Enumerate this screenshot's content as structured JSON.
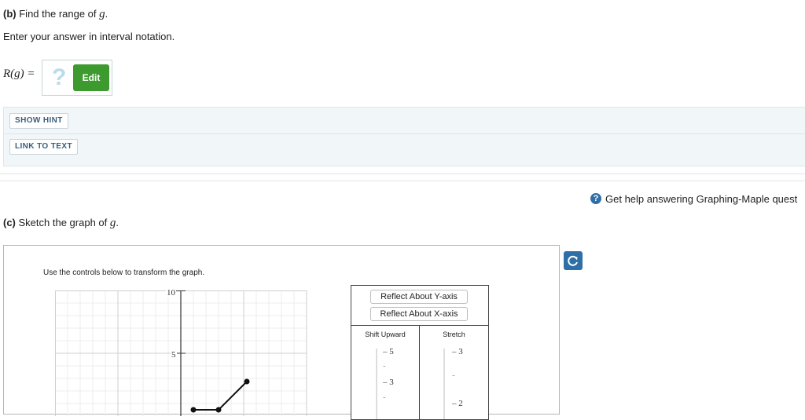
{
  "part_b": {
    "prefix": "(b)",
    "text": "Find the range of",
    "var": "g",
    "suffix": ".",
    "instruction": "Enter your answer in interval notation.",
    "answer_label": "R(g) =",
    "placeholder_symbol": "?",
    "edit_label": "Edit"
  },
  "hint": {
    "show_hint_label": "SHOW HINT",
    "link_to_text_label": "LINK TO TEXT"
  },
  "help": {
    "icon": "question-circle-icon",
    "text": "Get help answering Graphing-Maple quest"
  },
  "part_c": {
    "prefix": "(c)",
    "text": "Sketch the graph of",
    "var": "g",
    "suffix": "."
  },
  "graph": {
    "instruction": "Use the controls below to transform the graph.",
    "y_tick_10": "10",
    "y_tick_5": "5"
  },
  "controls": {
    "reflect_y": "Reflect About Y-axis",
    "reflect_x": "Reflect About X-axis",
    "shift_upward": "Shift Upward",
    "stretch": "Stretch",
    "shift_ticks": [
      "5",
      "3"
    ],
    "stretch_ticks": [
      "3",
      "2"
    ]
  },
  "colors": {
    "edit_green": "#3d9a2f",
    "help_blue": "#2f6fa7",
    "panel_bg": "#f1f6f9"
  }
}
